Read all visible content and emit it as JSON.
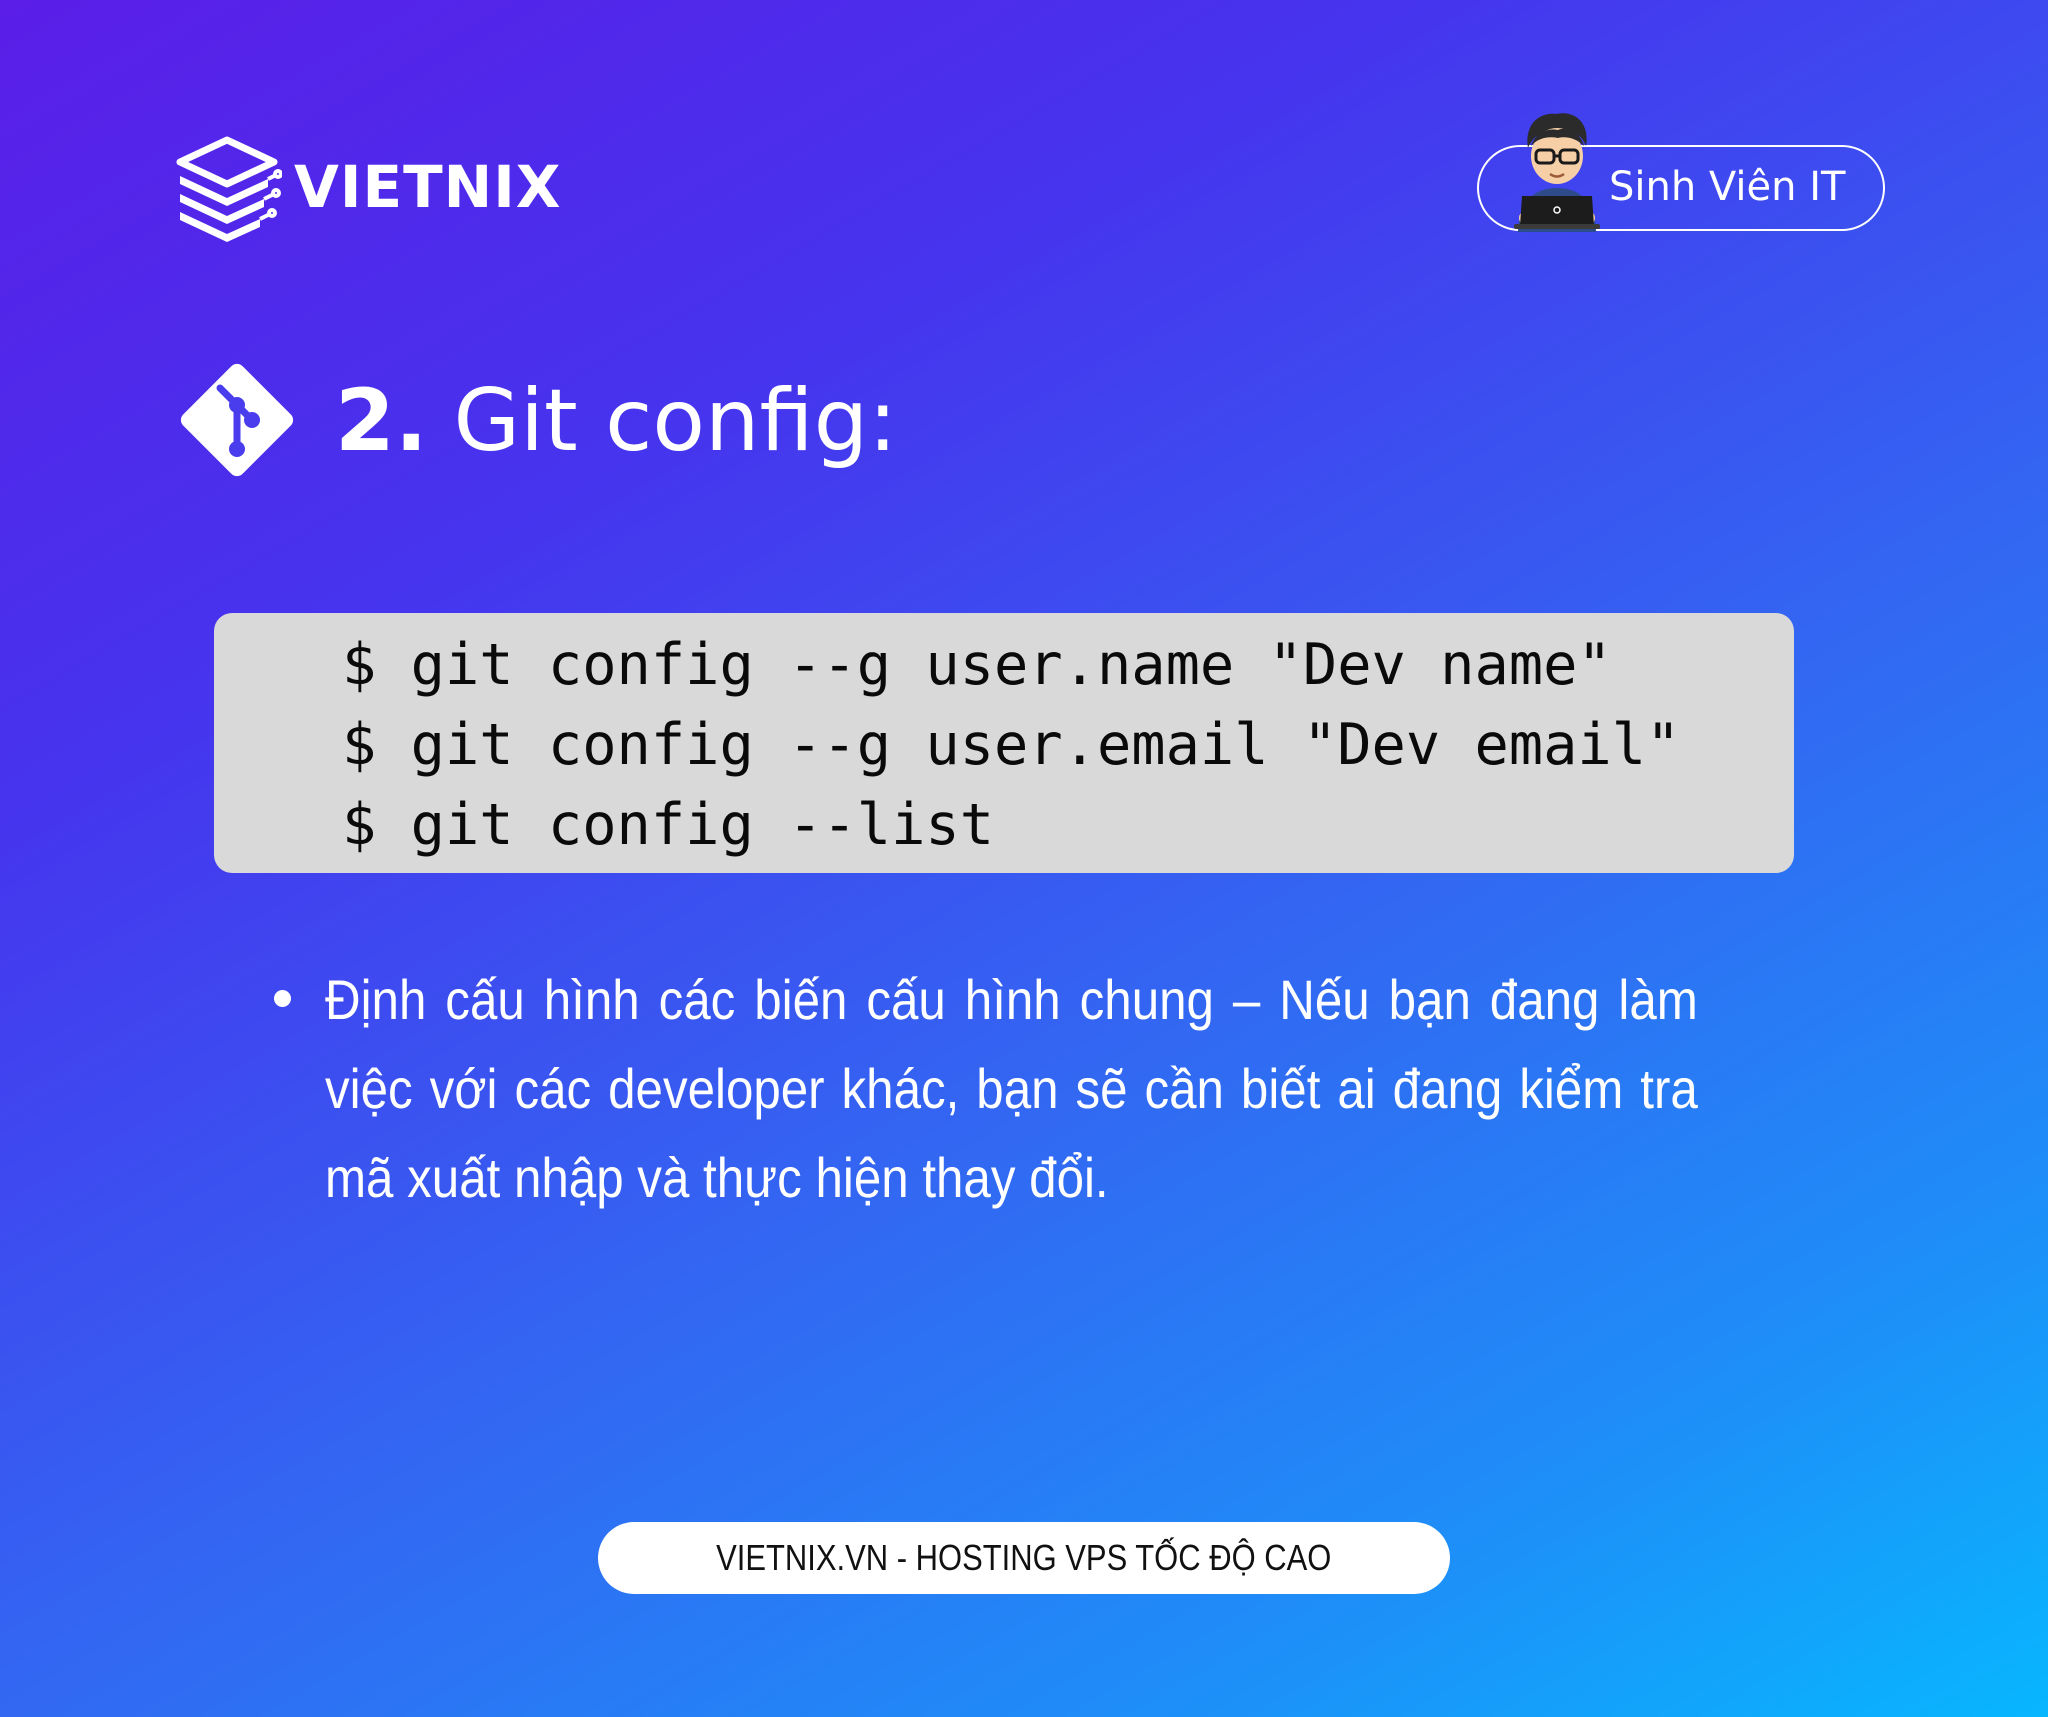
{
  "brand": {
    "name": "VIETNIX",
    "logo_icon": "stacked-layers-logo-icon"
  },
  "badge": {
    "label": "Sinh Viên IT",
    "avatar_icon": "developer-avatar-icon"
  },
  "heading": {
    "number": "2.",
    "title": "Git config:",
    "icon": "git-icon"
  },
  "code": {
    "lines": [
      "$ git config --g user.name \"Dev name\"",
      "$ git config --g user.email \"Dev email\"",
      "$ git config --list"
    ]
  },
  "bullet": {
    "text": "Định cấu hình các biến cấu hình chung – Nếu bạn đang làm việc với các developer khác, bạn sẽ cần biết ai đang kiểm tra mã xuất nhập và thực hiện thay đổi."
  },
  "footer": {
    "text": "VIETNIX.VN - HOSTING VPS TỐC ĐỘ CAO"
  },
  "colors": {
    "gradient_start": "#5a1ee8",
    "gradient_end": "#08b6fe",
    "code_background": "#d9d9d9",
    "text_primary": "#ffffff"
  }
}
